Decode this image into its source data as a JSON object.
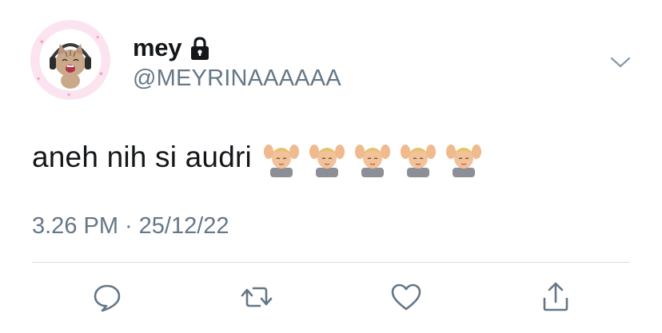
{
  "tweet": {
    "author": {
      "display_name": "mey",
      "handle": "@MEYRINAAAAAA",
      "protected_icon": "lock-icon",
      "avatar": "cat-with-headphones-avatar"
    },
    "text": "aneh nih si audri",
    "emojis": [
      "face-massage-emoji",
      "face-massage-emoji",
      "face-massage-emoji",
      "face-massage-emoji",
      "face-massage-emoji"
    ],
    "time": "3.26 PM",
    "separator": "·",
    "date": "25/12/22"
  },
  "menu_icon": "chevron-down-icon",
  "actions": [
    {
      "name": "reply",
      "icon": "comment-icon"
    },
    {
      "name": "retweet",
      "icon": "retweet-icon"
    },
    {
      "name": "like",
      "icon": "heart-icon"
    },
    {
      "name": "share",
      "icon": "share-icon"
    }
  ],
  "colors": {
    "text": "#14171a",
    "secondary": "#657786",
    "icon": "#657786",
    "divider": "#d9dfe3",
    "avatar_ring": "#f7c6dd"
  }
}
